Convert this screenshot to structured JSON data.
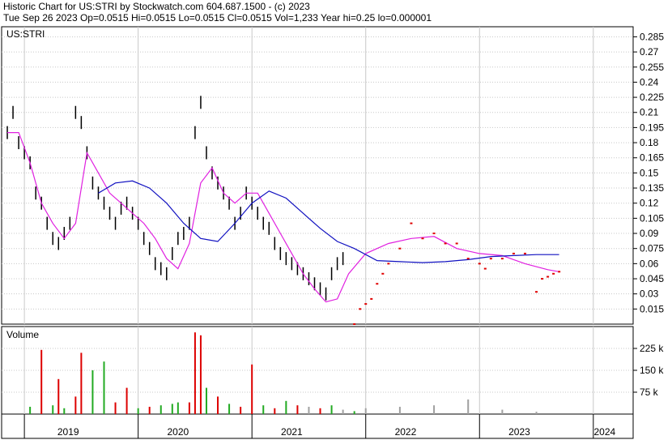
{
  "header": {
    "line1": "Historic Chart for US:STRI by Stockwatch.com 604.687.1500 - (c) 2023",
    "line2": "Tue Sep 26 2023   Op=0.0515   Hi=0.0515   Lo=0.0515   Cl=0.0515   Vol=1,233   Year hi=0.25   lo=0.000001"
  },
  "price_panel": {
    "symbol_label": "US:STRI"
  },
  "volume_panel": {
    "label": "Volume"
  },
  "colors": {
    "price_bars": "#000000",
    "ma_short": "#e020e0",
    "ma_long": "#1010c0",
    "dots": "#e00000",
    "vol_up": "#22aa22",
    "vol_down": "#dd0000",
    "vol_flat": "#a0a0a0",
    "grid": "#c8c8c8"
  },
  "chart_data": [
    {
      "type": "line",
      "title": "US:STRI",
      "ylim": [
        0.0,
        0.295
      ],
      "y_ticks": [
        0.285,
        0.27,
        0.255,
        0.24,
        0.225,
        0.21,
        0.195,
        0.18,
        0.165,
        0.15,
        0.135,
        0.12,
        0.105,
        0.09,
        0.075,
        0.06,
        0.045,
        0.03,
        0.015
      ],
      "x_tick_labels": [
        "2019",
        "2020",
        "2021",
        "2022",
        "2023",
        "2024"
      ],
      "grid": true,
      "series": [
        {
          "name": "",
          "kind": "close",
          "x": [
            2018.85,
            2018.9,
            2018.95,
            2019.0,
            2019.05,
            2019.1,
            2019.15,
            2019.2,
            2019.25,
            2019.3,
            2019.35,
            2019.4,
            2019.45,
            2019.5,
            2019.55,
            2019.6,
            2019.65,
            2019.7,
            2019.75,
            2019.8,
            2019.85,
            2019.9,
            2019.95,
            2020.0,
            2020.05,
            2020.1,
            2020.15,
            2020.2,
            2020.25,
            2020.3,
            2020.35,
            2020.4,
            2020.45,
            2020.5,
            2020.55,
            2020.6,
            2020.65,
            2020.7,
            2020.75,
            2020.8,
            2020.85,
            2020.9,
            2020.95,
            2021.0,
            2021.05,
            2021.1,
            2021.15,
            2021.2,
            2021.25,
            2021.3,
            2021.35,
            2021.4,
            2021.45,
            2021.5,
            2021.55,
            2021.6,
            2021.65,
            2021.7,
            2021.75,
            2021.8
          ],
          "y": [
            0.19,
            0.21,
            0.18,
            0.17,
            0.16,
            0.13,
            0.12,
            0.1,
            0.085,
            0.08,
            0.09,
            0.1,
            0.21,
            0.2,
            0.17,
            0.14,
            0.13,
            0.12,
            0.11,
            0.1,
            0.115,
            0.12,
            0.11,
            0.1,
            0.085,
            0.075,
            0.06,
            0.055,
            0.05,
            0.07,
            0.085,
            0.09,
            0.1,
            0.19,
            0.22,
            0.17,
            0.15,
            0.14,
            0.13,
            0.12,
            0.1,
            0.11,
            0.13,
            0.12,
            0.11,
            0.1,
            0.095,
            0.08,
            0.07,
            0.065,
            0.06,
            0.055,
            0.05,
            0.045,
            0.04,
            0.035,
            0.03,
            0.05,
            0.06,
            0.065
          ]
        },
        {
          "name": "",
          "kind": "ma_short",
          "x": [
            2018.85,
            2018.95,
            2019.05,
            2019.15,
            2019.25,
            2019.35,
            2019.45,
            2019.55,
            2019.65,
            2019.75,
            2019.85,
            2019.95,
            2020.05,
            2020.15,
            2020.25,
            2020.35,
            2020.45,
            2020.55,
            2020.65,
            2020.75,
            2020.85,
            2020.95,
            2021.05,
            2021.15,
            2021.25,
            2021.35,
            2021.45,
            2021.55,
            2021.65,
            2021.75,
            2021.85,
            2022.0,
            2022.2,
            2022.4,
            2022.6,
            2022.8,
            2023.0,
            2023.2,
            2023.4,
            2023.6,
            2023.7
          ],
          "y": [
            0.19,
            0.19,
            0.16,
            0.12,
            0.1,
            0.085,
            0.1,
            0.17,
            0.15,
            0.13,
            0.12,
            0.11,
            0.1,
            0.085,
            0.065,
            0.055,
            0.08,
            0.14,
            0.155,
            0.13,
            0.12,
            0.13,
            0.13,
            0.11,
            0.09,
            0.07,
            0.05,
            0.035,
            0.022,
            0.025,
            0.05,
            0.07,
            0.08,
            0.085,
            0.087,
            0.075,
            0.07,
            0.068,
            0.06,
            0.054,
            0.052
          ]
        },
        {
          "name": "",
          "kind": "ma_long",
          "x": [
            2019.65,
            2019.8,
            2019.95,
            2020.1,
            2020.25,
            2020.4,
            2020.55,
            2020.7,
            2020.85,
            2021.0,
            2021.15,
            2021.3,
            2021.45,
            2021.6,
            2021.75,
            2021.9,
            2022.1,
            2022.3,
            2022.5,
            2022.7,
            2022.9,
            2023.1,
            2023.3,
            2023.5,
            2023.7
          ],
          "y": [
            0.13,
            0.14,
            0.142,
            0.135,
            0.12,
            0.1,
            0.085,
            0.082,
            0.1,
            0.12,
            0.132,
            0.125,
            0.11,
            0.095,
            0.082,
            0.075,
            0.063,
            0.062,
            0.061,
            0.062,
            0.064,
            0.067,
            0.068,
            0.069,
            0.069
          ]
        },
        {
          "name": "",
          "kind": "dots",
          "x": [
            2021.9,
            2021.95,
            2022.0,
            2022.05,
            2022.1,
            2022.15,
            2022.2,
            2022.3,
            2022.4,
            2022.5,
            2022.6,
            2022.7,
            2022.8,
            2022.9,
            2023.0,
            2023.05,
            2023.1,
            2023.2,
            2023.3,
            2023.4,
            2023.5,
            2023.55,
            2023.6,
            2023.65,
            2023.7
          ],
          "y": [
            0.0,
            0.015,
            0.02,
            0.025,
            0.04,
            0.05,
            0.06,
            0.075,
            0.1,
            0.085,
            0.09,
            0.08,
            0.08,
            0.065,
            0.06,
            0.055,
            0.065,
            0.065,
            0.07,
            0.07,
            0.032,
            0.045,
            0.047,
            0.05,
            0.052
          ]
        }
      ]
    },
    {
      "type": "bar",
      "title": "Volume",
      "ylim": [
        0,
        300000
      ],
      "y_ticks": [
        225000,
        150000,
        75000
      ],
      "y_tick_labels": [
        "225 k",
        "150 k",
        "75 k"
      ],
      "x_tick_labels": [
        "2019",
        "2020",
        "2021",
        "2022",
        "2023",
        "2024"
      ],
      "x": [
        2019.05,
        2019.15,
        2019.25,
        2019.3,
        2019.35,
        2019.45,
        2019.5,
        2019.6,
        2019.7,
        2019.8,
        2019.9,
        2020.0,
        2020.1,
        2020.2,
        2020.3,
        2020.35,
        2020.45,
        2020.5,
        2020.55,
        2020.6,
        2020.7,
        2020.8,
        2020.9,
        2021.0,
        2021.1,
        2021.2,
        2021.3,
        2021.4,
        2021.5,
        2021.6,
        2021.7,
        2021.8,
        2021.9,
        2022.0,
        2022.3,
        2022.6,
        2022.9,
        2023.2,
        2023.5
      ],
      "values": [
        25000,
        220000,
        30000,
        120000,
        20000,
        60000,
        210000,
        150000,
        180000,
        40000,
        90000,
        20000,
        25000,
        30000,
        35000,
        40000,
        40000,
        280000,
        270000,
        90000,
        60000,
        35000,
        25000,
        170000,
        30000,
        20000,
        45000,
        30000,
        25000,
        20000,
        30000,
        15000,
        10000,
        20000,
        25000,
        30000,
        50000,
        15000,
        8000
      ],
      "direction": [
        "up",
        "down",
        "up",
        "down",
        "up",
        "down",
        "down",
        "up",
        "up",
        "down",
        "down",
        "up",
        "down",
        "up",
        "up",
        "up",
        "down",
        "down",
        "down",
        "up",
        "down",
        "up",
        "down",
        "down",
        "up",
        "down",
        "up",
        "down",
        "flat",
        "down",
        "up",
        "flat",
        "up",
        "flat",
        "flat",
        "flat",
        "flat",
        "flat",
        "flat"
      ]
    }
  ]
}
